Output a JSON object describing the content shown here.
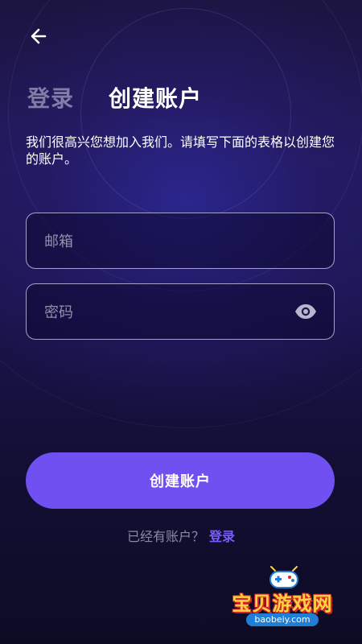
{
  "header": {
    "back_icon": "arrow-left-icon",
    "tab_login": "登录",
    "tab_create": "创建账户"
  },
  "intro_text": "我们很高兴您想加入我们。请填写下面的表格以创建您的账户。",
  "form": {
    "email": {
      "placeholder": "邮箱",
      "value": ""
    },
    "password": {
      "placeholder": "密码",
      "value": "",
      "toggle_icon": "eye-icon"
    }
  },
  "submit_label": "创建账户",
  "footer": {
    "prompt": "已经有账户？",
    "login_link": "登录"
  },
  "watermark": {
    "title": "宝贝游戏网",
    "url": "baobeiy.com"
  },
  "colors": {
    "accent": "#7050f0",
    "link": "#7a5cff",
    "background_dark": "#0d0b22"
  }
}
